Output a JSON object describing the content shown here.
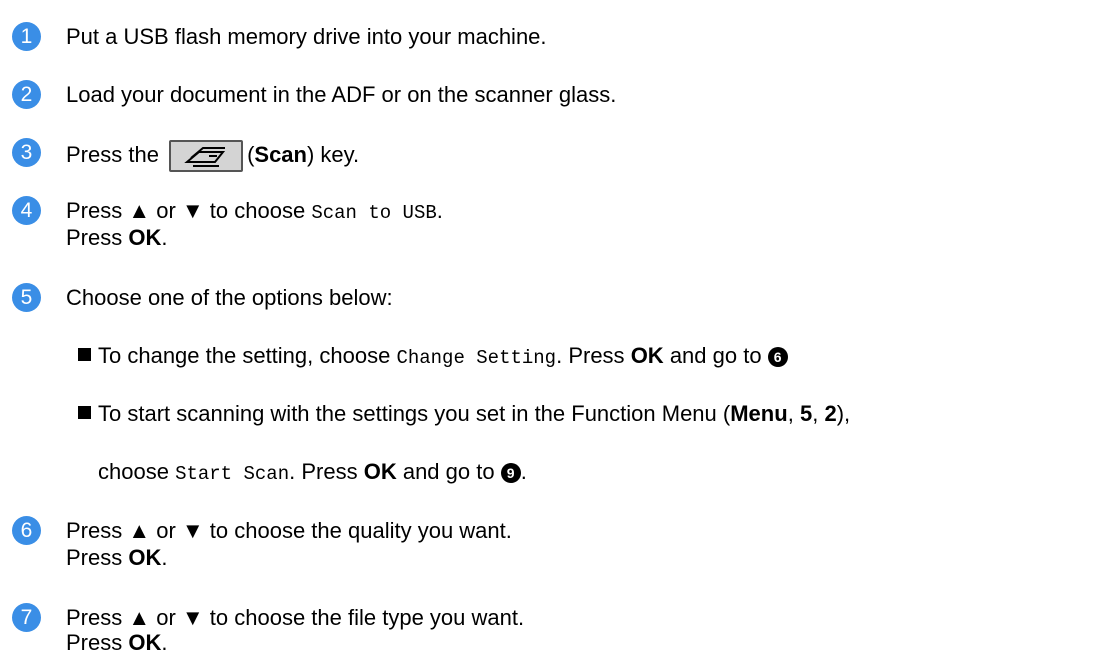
{
  "steps": [
    {
      "number": "1",
      "lines": [
        {
          "text": "Put a USB flash memory drive into your machine."
        }
      ]
    },
    {
      "number": "2",
      "lines": [
        {
          "text": "Load your document in the ADF or on the scanner glass."
        }
      ]
    },
    {
      "number": "3",
      "lines": [
        {
          "pre": "Press the",
          "paren_open": "(",
          "key_label": "Scan",
          "post": ") key."
        }
      ]
    },
    {
      "number": "4",
      "lines": [
        {
          "pre": "Press ▲ or ▼ to choose",
          "code": "Scan to USB",
          "post": "."
        },
        {
          "pre": "Press",
          "bold": "OK",
          "post": "."
        }
      ]
    },
    {
      "number": "5",
      "lines": [
        {
          "text": "Choose one of the options below:"
        },
        {
          "pre": "To change the setting, choose",
          "code": "Change Setting",
          "mid": ". Press",
          "bold": "OK",
          "post": "and go to",
          "ref": "6"
        },
        {
          "pre": "To start scanning with the settings you set in the Function Menu (",
          "b1": "Menu",
          "c1": ",",
          "b2": "5",
          "c2": ",",
          "b3": "2",
          "post": "),",
          "pre2": "choose",
          "code": "Start Scan",
          "mid": ". Press",
          "bold": "OK",
          "post2": "and go to",
          "ref": "9",
          "end": "."
        }
      ]
    },
    {
      "number": "6",
      "lines": [
        {
          "text": "Press ▲ or ▼ to choose the quality you want."
        },
        {
          "pre": "Press",
          "bold": "OK",
          "post": "."
        }
      ]
    },
    {
      "number": "7",
      "lines": [
        {
          "text": "Press ▲ or ▼ to choose the file type you want."
        },
        {
          "pre": "Press",
          "bold": "OK",
          "post": "."
        }
      ]
    }
  ],
  "colors": {
    "step_badge": "#3a8ee6"
  },
  "icons": {
    "scan_key": "scan-key-icon",
    "bullet": "square-bullet"
  }
}
